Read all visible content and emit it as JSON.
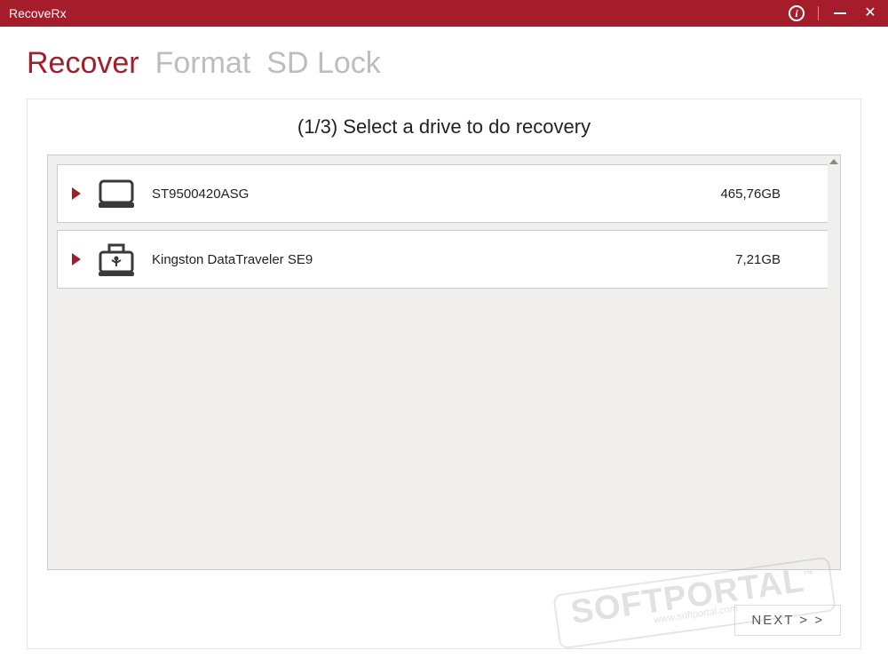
{
  "window": {
    "title": "RecoveRx"
  },
  "tabs": {
    "recover": "Recover",
    "format": "Format",
    "sdlock": "SD Lock",
    "active": "recover"
  },
  "step": {
    "title": "(1/3) Select a drive to do recovery"
  },
  "drives": [
    {
      "name": "ST9500420ASG",
      "size": "465,76GB",
      "type": "hdd"
    },
    {
      "name": "Kingston DataTraveler SE9",
      "size": "7,21GB",
      "type": "usb"
    }
  ],
  "buttons": {
    "next": "NEXT  > >"
  },
  "watermark": {
    "text": "SOFTPORTAL",
    "sub": "www.softportal.com",
    "tm": "™"
  }
}
